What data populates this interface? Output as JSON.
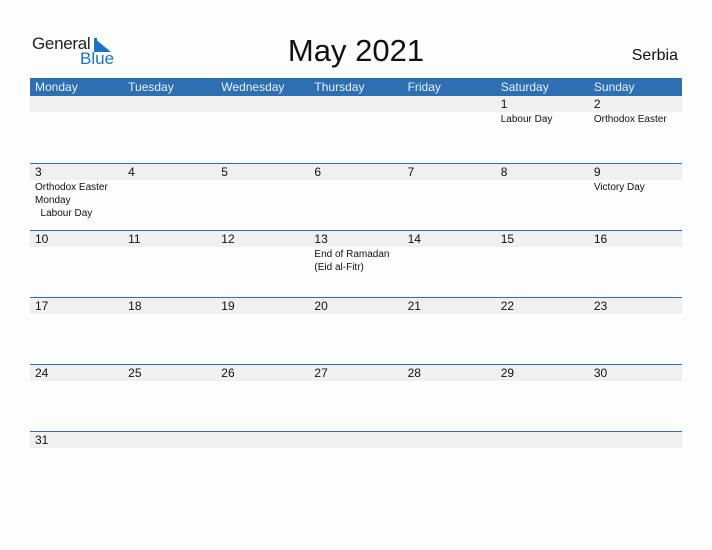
{
  "logo": {
    "line1": "General",
    "line2": "Blue"
  },
  "title": "May 2021",
  "country": "Serbia",
  "accent_color": "#2e6fb2",
  "weekdays": [
    "Monday",
    "Tuesday",
    "Wednesday",
    "Thursday",
    "Friday",
    "Saturday",
    "Sunday"
  ],
  "weeks": [
    [
      {
        "day": "",
        "event": ""
      },
      {
        "day": "",
        "event": ""
      },
      {
        "day": "",
        "event": ""
      },
      {
        "day": "",
        "event": ""
      },
      {
        "day": "",
        "event": ""
      },
      {
        "day": "1",
        "event": "Labour Day"
      },
      {
        "day": "2",
        "event": "Orthodox Easter"
      }
    ],
    [
      {
        "day": "3",
        "event": "Orthodox Easter\nMonday\n  Labour Day"
      },
      {
        "day": "4",
        "event": ""
      },
      {
        "day": "5",
        "event": ""
      },
      {
        "day": "6",
        "event": ""
      },
      {
        "day": "7",
        "event": ""
      },
      {
        "day": "8",
        "event": ""
      },
      {
        "day": "9",
        "event": "Victory Day"
      }
    ],
    [
      {
        "day": "10",
        "event": ""
      },
      {
        "day": "11",
        "event": ""
      },
      {
        "day": "12",
        "event": ""
      },
      {
        "day": "13",
        "event": "End of Ramadan\n(Eid al-Fitr)"
      },
      {
        "day": "14",
        "event": ""
      },
      {
        "day": "15",
        "event": ""
      },
      {
        "day": "16",
        "event": ""
      }
    ],
    [
      {
        "day": "17",
        "event": ""
      },
      {
        "day": "18",
        "event": ""
      },
      {
        "day": "19",
        "event": ""
      },
      {
        "day": "20",
        "event": ""
      },
      {
        "day": "21",
        "event": ""
      },
      {
        "day": "22",
        "event": ""
      },
      {
        "day": "23",
        "event": ""
      }
    ],
    [
      {
        "day": "24",
        "event": ""
      },
      {
        "day": "25",
        "event": ""
      },
      {
        "day": "26",
        "event": ""
      },
      {
        "day": "27",
        "event": ""
      },
      {
        "day": "28",
        "event": ""
      },
      {
        "day": "29",
        "event": ""
      },
      {
        "day": "30",
        "event": ""
      }
    ],
    [
      {
        "day": "31",
        "event": ""
      },
      {
        "day": "",
        "event": ""
      },
      {
        "day": "",
        "event": ""
      },
      {
        "day": "",
        "event": ""
      },
      {
        "day": "",
        "event": ""
      },
      {
        "day": "",
        "event": ""
      },
      {
        "day": "",
        "event": ""
      }
    ]
  ]
}
